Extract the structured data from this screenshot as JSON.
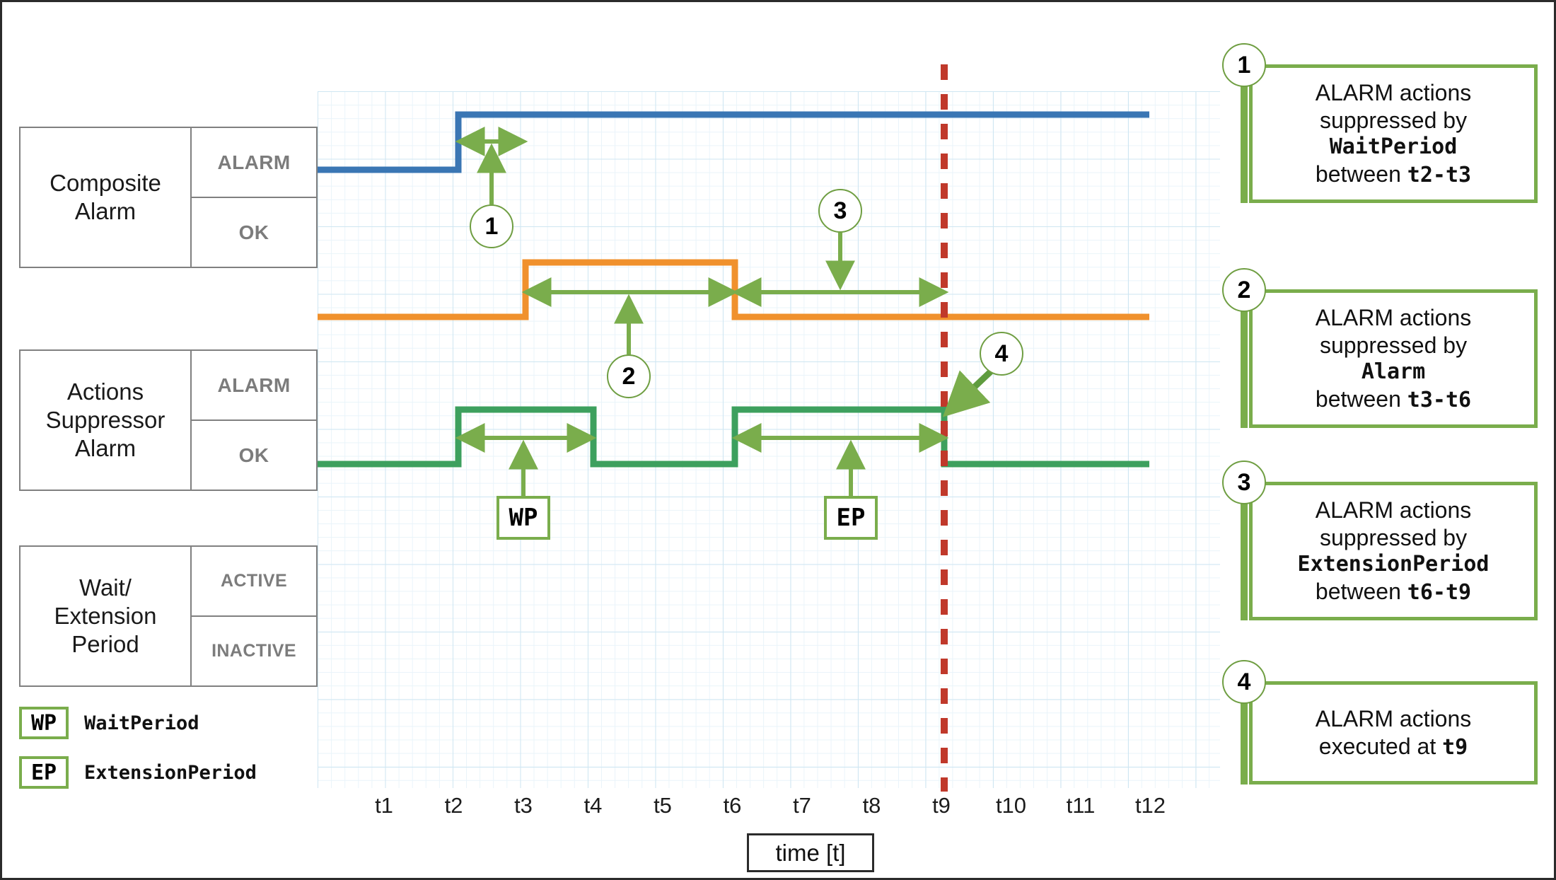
{
  "colors": {
    "composite": "#3a76b4",
    "suppressor": "#f0912d",
    "waitperiod": "#3da05e",
    "annotation": "#7aad4c",
    "marker_line": "#c0392b",
    "grid": "#cfe6f2",
    "frame": "#2b2b2b"
  },
  "state_rows": [
    {
      "name": "Composite\nAlarm",
      "high_label": "ALARM",
      "low_label": "OK"
    },
    {
      "name": "Actions\nSuppressor\nAlarm",
      "high_label": "ALARM",
      "low_label": "OK"
    },
    {
      "name": "Wait/\nExtension\nPeriod",
      "high_label": "ACTIVE",
      "low_label": "INACTIVE"
    }
  ],
  "legend": [
    {
      "chip": "WP",
      "label": "WaitPeriod"
    },
    {
      "chip": "EP",
      "label": "ExtensionPeriod"
    }
  ],
  "plot_markers": [
    {
      "chip": "WP"
    },
    {
      "chip": "EP"
    }
  ],
  "axis": {
    "label": "time [t]",
    "ticks": [
      "t1",
      "t2",
      "t3",
      "t4",
      "t5",
      "t6",
      "t7",
      "t8",
      "t9",
      "t10",
      "t11",
      "t12"
    ]
  },
  "bubbles": [
    {
      "id": "1"
    },
    {
      "id": "2"
    },
    {
      "id": "3"
    },
    {
      "id": "4"
    }
  ],
  "callouts": [
    {
      "num": "1",
      "line1": "ALARM actions",
      "line2": "suppressed by",
      "mono": "WaitPeriod",
      "line4_pre": "between ",
      "line4_mono": "t2-t3"
    },
    {
      "num": "2",
      "line1": "ALARM actions",
      "line2": "suppressed by",
      "mono": "Alarm",
      "line4_pre": "between ",
      "line4_mono": "t3-t6"
    },
    {
      "num": "3",
      "line1": "ALARM actions",
      "line2": "suppressed by",
      "mono": "ExtensionPeriod",
      "line4_pre": "between ",
      "line4_mono": "t6-t9"
    },
    {
      "num": "4",
      "line1": "ALARM actions",
      "line2_pre": "executed at ",
      "line2_mono": "t9"
    }
  ],
  "chart_data": {
    "type": "line",
    "title": "",
    "xlabel": "time [t]",
    "ylabel": "",
    "x": [
      "t1",
      "t2",
      "t3",
      "t4",
      "t5",
      "t6",
      "t7",
      "t8",
      "t9",
      "t10",
      "t11",
      "t12"
    ],
    "grid": true,
    "legend_position": "left-boxes",
    "series": [
      {
        "name": "Composite Alarm",
        "color": "#3a76b4",
        "states": [
          "OK",
          "ALARM"
        ],
        "step_points": [
          {
            "t": "t0",
            "state": "OK"
          },
          {
            "t": "t2",
            "state": "ALARM"
          },
          {
            "t": "t12",
            "state": "ALARM"
          }
        ]
      },
      {
        "name": "Actions Suppressor Alarm",
        "color": "#f0912d",
        "states": [
          "OK",
          "ALARM"
        ],
        "step_points": [
          {
            "t": "t0",
            "state": "OK"
          },
          {
            "t": "t3",
            "state": "ALARM"
          },
          {
            "t": "t6",
            "state": "OK"
          },
          {
            "t": "t12",
            "state": "OK"
          }
        ]
      },
      {
        "name": "Wait/Extension Period",
        "color": "#3da05e",
        "states": [
          "INACTIVE",
          "ACTIVE"
        ],
        "step_points": [
          {
            "t": "t0",
            "state": "INACTIVE"
          },
          {
            "t": "t2",
            "state": "ACTIVE"
          },
          {
            "t": "t4",
            "state": "INACTIVE"
          },
          {
            "t": "t6",
            "state": "ACTIVE"
          },
          {
            "t": "t9",
            "state": "INACTIVE"
          },
          {
            "t": "t12",
            "state": "INACTIVE"
          }
        ]
      }
    ],
    "annotations": [
      {
        "id": "1",
        "span": [
          "t2",
          "t3"
        ],
        "row": "Composite Alarm",
        "label": "WaitPeriod suppression"
      },
      {
        "id": "2",
        "span": [
          "t3",
          "t6"
        ],
        "row": "Actions Suppressor Alarm",
        "label": "Alarm suppression"
      },
      {
        "id": "3",
        "span": [
          "t6",
          "t9"
        ],
        "row": "Actions Suppressor Alarm",
        "label": "ExtensionPeriod suppression"
      },
      {
        "id": "4",
        "at": "t9",
        "row": "Wait/Extension Period",
        "label": "ALARM actions executed"
      },
      {
        "id": "WP",
        "span": [
          "t2",
          "t4"
        ],
        "row": "Wait/Extension Period",
        "label": "WaitPeriod"
      },
      {
        "id": "EP",
        "span": [
          "t6",
          "t9"
        ],
        "row": "Wait/Extension Period",
        "label": "ExtensionPeriod"
      }
    ],
    "marker_line": {
      "t": "t9",
      "style": "dashed",
      "color": "#c0392b"
    }
  }
}
